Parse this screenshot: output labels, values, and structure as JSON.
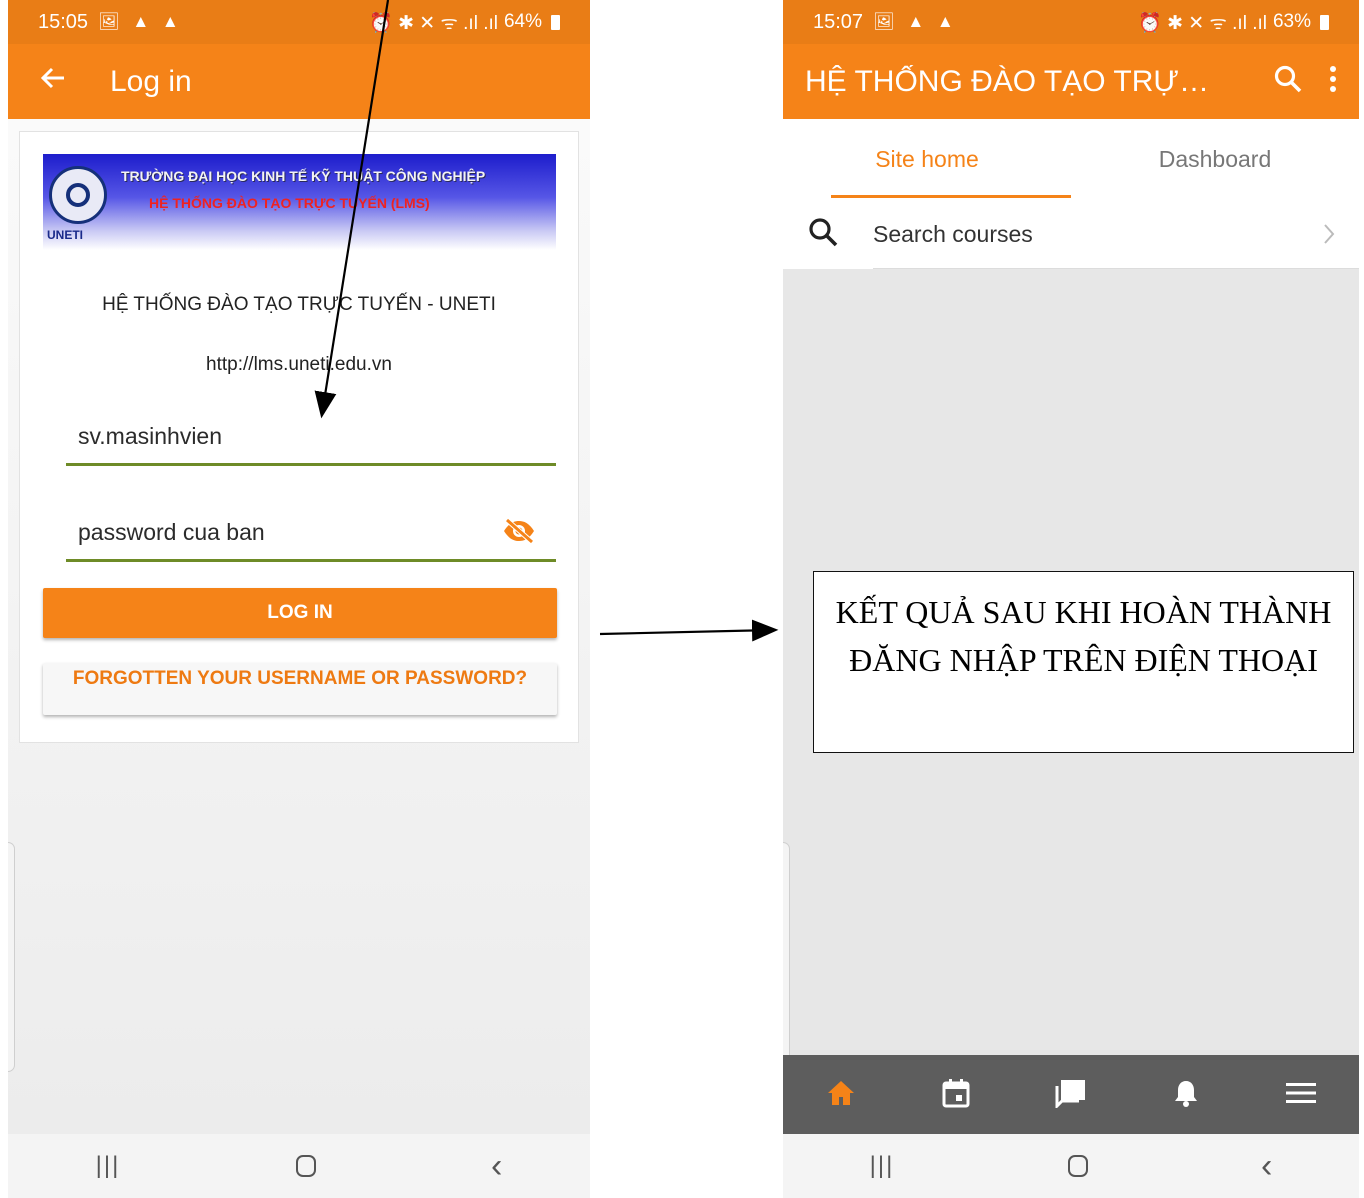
{
  "left_phone": {
    "status": {
      "time": "15:05",
      "icons": "🖼 ▲ ▲",
      "right_icons": "⏰ ✱ ✕ ᯤ .ıl .ıl",
      "battery": "64%"
    },
    "appbar": {
      "title": "Log in"
    },
    "banner": {
      "line1": "TRƯỜNG ĐẠI HỌC KINH TẾ KỸ THUẬT CÔNG NGHIỆP",
      "line2": "HỆ THỐNG ĐÀO TẠO TRỰC TUYẾN (LMS)",
      "abbr": "UNETI"
    },
    "site_name": "HỆ THỐNG ĐÀO TẠO TRỰC TUYẾN - UNETI",
    "site_url": "http://lms.uneti.edu.vn",
    "username_value": "sv.masinhvien",
    "password_value": "password cua ban",
    "login_button": "LOG IN",
    "forgot_button": "FORGOTTEN YOUR USERNAME OR PASSWORD?",
    "nav": {
      "recent": "|||",
      "back": "‹"
    }
  },
  "right_phone": {
    "status": {
      "time": "15:07",
      "icons": "🖼 ▲ ▲",
      "right_icons": "⏰ ✱ ✕ ᯤ .ıl .ıl",
      "battery": "63%"
    },
    "appbar": {
      "title": "HỆ THỐNG ĐÀO TẠO TRỰC TUYẾN - UNETI"
    },
    "tabs": [
      "Site home",
      "Dashboard"
    ],
    "search_label": "Search courses",
    "bottom_tabs": [
      "home-icon",
      "calendar-icon",
      "messages-icon",
      "notifications-icon",
      "menu-icon"
    ],
    "nav": {
      "recent": "|||",
      "back": "‹"
    }
  },
  "annotation": {
    "text": "KẾT QUẢ SAU KHI HOÀN THÀNH ĐĂNG NHẬP TRÊN ĐIỆN THOẠI"
  },
  "colors": {
    "appbar": "#f58318",
    "statusbar": "#e97d16",
    "field_underline": "#6e8b27",
    "bottom_tab_bg": "#5d5d5d",
    "active_tab": "#f58318"
  }
}
